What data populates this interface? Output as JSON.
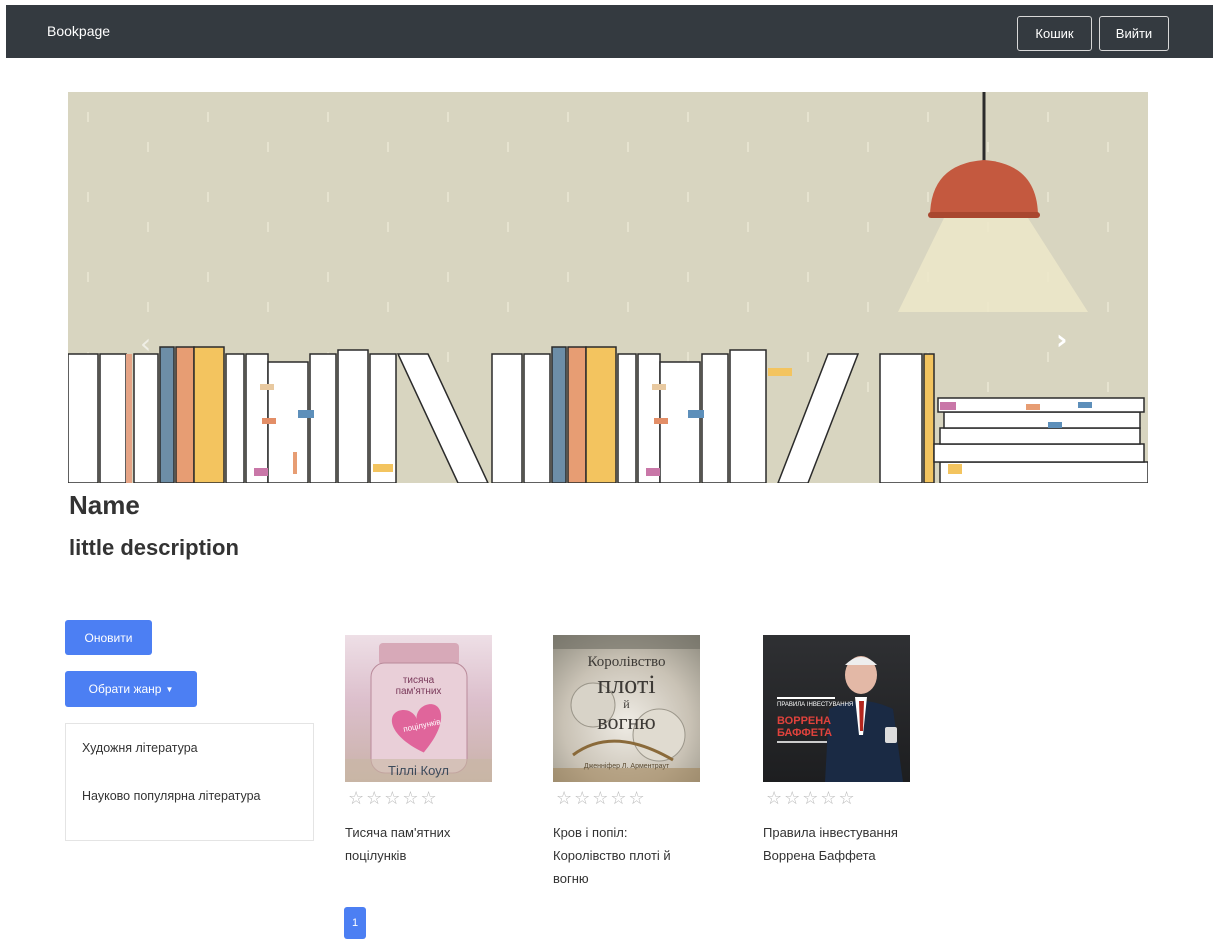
{
  "navbar": {
    "brand": "Bookpage",
    "cart_label": "Кошик",
    "logout_label": "Вийти"
  },
  "carousel": {
    "prev_icon": "chevron-left-icon",
    "next_icon": "chevron-right-icon"
  },
  "hero": {
    "title": "Name",
    "subtitle": "little description"
  },
  "sidebar": {
    "refresh_label": "Оновити",
    "genre_dropdown_label": "Обрати жанр",
    "genres": [
      "Художня література",
      "Науково популярна література"
    ]
  },
  "books": [
    {
      "title": "Тисяча пам'ятних поцілунків",
      "cover_text": [
        "тисяча",
        "пам'ятних",
        "поцілунків",
        "Тіллі Коул"
      ],
      "rating": 0
    },
    {
      "title": "Кров і попіл: Королівство плоті й вогню",
      "cover_text": [
        "Королівство",
        "плоті",
        "й",
        "вогню",
        "Дженніфер Л. Арментраут"
      ],
      "rating": 0
    },
    {
      "title": "Правила інвестування Воррена Баффета",
      "cover_text": [
        "ПРАВИЛА ІНВЕСТУВАННЯ",
        "ВОРРЕНА",
        "БАФФЕТА"
      ],
      "rating": 0
    }
  ],
  "pagination": {
    "current_page": "1"
  },
  "colors": {
    "navbar_bg": "#343a40",
    "primary": "#4c7ff3",
    "carousel_bg": "#d8d5c0"
  }
}
